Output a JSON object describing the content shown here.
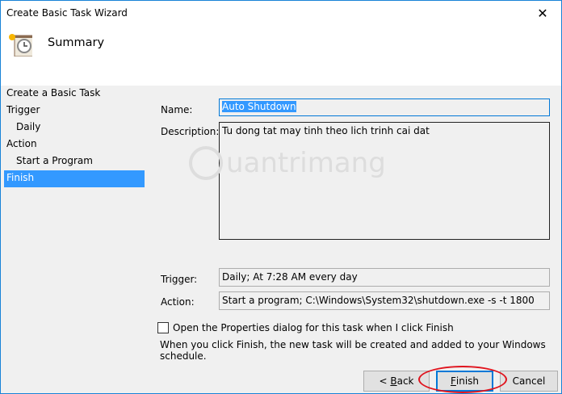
{
  "window": {
    "title": "Create Basic Task Wizard",
    "close_label": "✕"
  },
  "header": {
    "title": "Summary",
    "icon": "task-scheduler-clock-icon"
  },
  "nav": {
    "items": [
      {
        "label": "Create a Basic Task"
      },
      {
        "label": "Trigger"
      },
      {
        "label": "Daily"
      },
      {
        "label": "Action"
      },
      {
        "label": "Start a Program"
      },
      {
        "label": "Finish"
      }
    ]
  },
  "form": {
    "name_label": "Name:",
    "name_value": "Auto Shutdown",
    "description_label": "Description:",
    "description_value": "Tu dong tat may tinh theo lich trinh cai dat",
    "trigger_label": "Trigger:",
    "trigger_value": "Daily; At 7:28 AM every day",
    "action_label": "Action:",
    "action_value": "Start a program; C:\\Windows\\System32\\shutdown.exe -s -t 1800"
  },
  "options": {
    "open_properties_label": "Open the Properties dialog for this task when I click Finish",
    "open_properties_checked": false,
    "note": "When you click Finish, the new task will be created and added to your Windows schedule."
  },
  "buttons": {
    "back_prefix": "< ",
    "back_key": "B",
    "back_rest": "ack",
    "finish_key": "F",
    "finish_rest": "inish",
    "cancel": "Cancel"
  },
  "watermark": "uantrimang",
  "colors": {
    "accent": "#0078d7",
    "selection": "#3399ff",
    "highlight_ring": "#e0141e"
  }
}
